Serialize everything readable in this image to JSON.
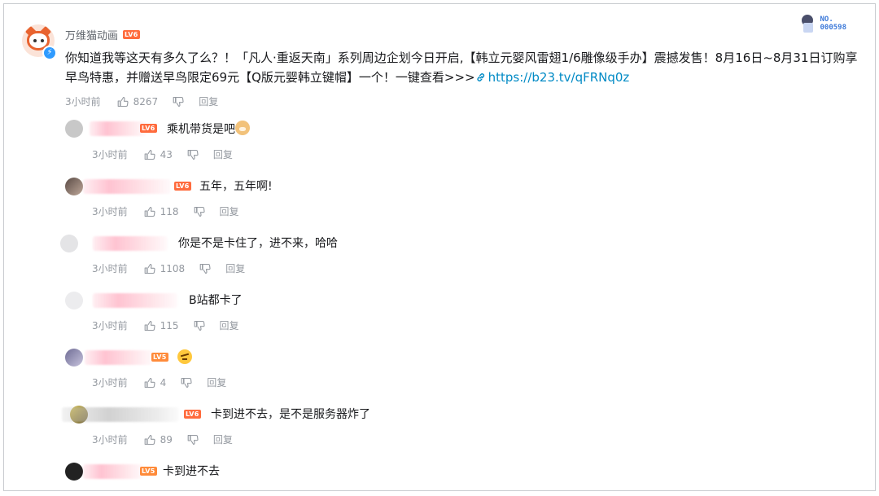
{
  "main": {
    "author": "万维猫动画",
    "level": "LV6",
    "medal_label": "NO.",
    "medal_number": "000598",
    "text_before_link": "你知道我等这天有多久了么？！「凡人·重返天南」系列周边企划今日开启,【韩立元婴风雷翅1/6雕像级手办】震撼发售！8月16日~8月31日订购享早鸟特惠，并赠送早鸟限定69元【Q版元婴韩立键帽】一个！一键查看>>>",
    "link_text": "https://b23.tv/qFRNq0z",
    "time": "3小时前",
    "likes": "8267",
    "reply_label": "回复"
  },
  "replies": [
    {
      "level": "LV6",
      "text": "乘机带货是吧",
      "emoji": "doge-emoji",
      "time": "3小时前",
      "likes": "43",
      "reply_label": "回复"
    },
    {
      "level": "LV6",
      "text": "五年，五年啊!",
      "emoji": "",
      "time": "3小时前",
      "likes": "118",
      "reply_label": "回复"
    },
    {
      "level": "",
      "text": "你是不是卡住了，进不来，哈哈",
      "emoji": "",
      "time": "3小时前",
      "likes": "1108",
      "reply_label": "回复"
    },
    {
      "level": "",
      "text": "B站都卡了",
      "emoji": "",
      "time": "3小时前",
      "likes": "115",
      "reply_label": "回复"
    },
    {
      "level": "LV5",
      "text": "",
      "emoji": "angry-emoji",
      "time": "3小时前",
      "likes": "4",
      "reply_label": "回复"
    },
    {
      "level": "LV6",
      "text": "卡到进不去，是不是服务器炸了",
      "emoji": "",
      "time": "3小时前",
      "likes": "89",
      "reply_label": "回复"
    },
    {
      "level": "LV5",
      "text": "卡到进不去",
      "emoji": "",
      "time": "",
      "likes": "",
      "reply_label": ""
    }
  ],
  "colors": {
    "link": "#008ac5",
    "meta": "#9499a0",
    "level_badge": "#ff6b3d"
  }
}
